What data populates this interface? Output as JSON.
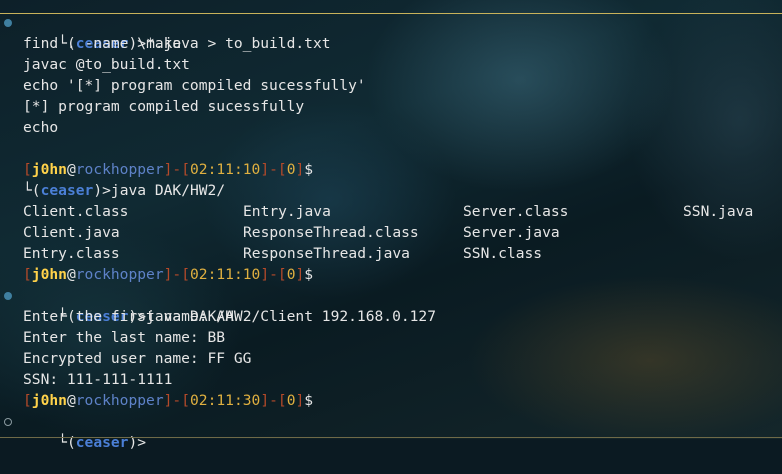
{
  "prompt": {
    "corner": "└",
    "user": "ceaser",
    "gt": ">",
    "tag_user": "j0hn",
    "at": "@",
    "host": "rockhopper",
    "time1": "02:11:10",
    "time2": "02:11:10",
    "time3": "02:11:30",
    "status": "0",
    "dollar": "$"
  },
  "lines": {
    "cmd_make": "make",
    "out1": "find . -name \\*.java > to_build.txt",
    "out2": "javac @to_build.txt",
    "out3": "echo '[*] program compiled sucessfully'",
    "out4": "[*] program compiled sucessfully",
    "out5": "echo",
    "cmd_ls": "java DAK/HW2/",
    "cmd_run": "java DAK/HW2/Client 192.168.0.127",
    "run1": "Enter the first name: AA",
    "run2": "Enter the last name: BB",
    "run3": "Encrypted user name: FF GG",
    "run4": "SSN: 111-111-1111"
  },
  "listing": [
    [
      "Client.class",
      "Entry.java",
      "Server.class",
      "SSN.java"
    ],
    [
      "Client.java",
      "ResponseThread.class",
      "Server.java",
      ""
    ],
    [
      "Entry.class",
      "ResponseThread.java",
      "SSN.class",
      ""
    ]
  ],
  "colors": {
    "user": "#4b7fd6",
    "bracket": "#b54a2a",
    "tag_user": "#ffd24a",
    "time": "#e0b040"
  }
}
